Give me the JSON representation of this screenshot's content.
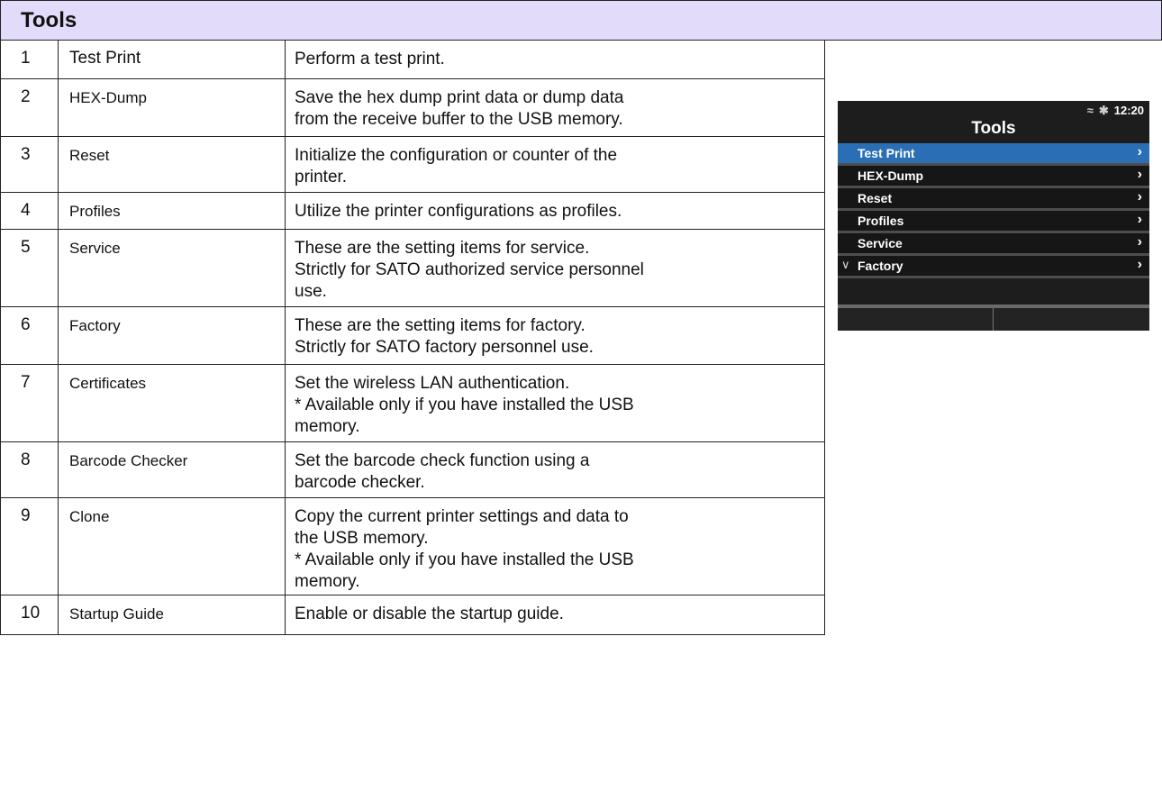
{
  "header": {
    "title": "Tools"
  },
  "rows": [
    {
      "num": "1",
      "name": "Test Print",
      "desc": [
        "Perform a test print."
      ]
    },
    {
      "num": "2",
      "name": "HEX-Dump",
      "desc": [
        "Save the hex dump print data or dump data",
        "from the receive buffer to the USB memory."
      ]
    },
    {
      "num": "3",
      "name": "Reset",
      "desc": [
        "Initialize the configuration or counter of the",
        "printer."
      ]
    },
    {
      "num": "4",
      "name": "Profiles",
      "desc": [
        "Utilize the printer configurations as profiles."
      ]
    },
    {
      "num": "5",
      "name": "Service",
      "desc": [
        "These are the setting items for service.",
        "Strictly for SATO authorized service personnel",
        "use."
      ]
    },
    {
      "num": "6",
      "name": "Factory",
      "desc": [
        "These are the setting items for factory.",
        "Strictly for SATO factory personnel use."
      ]
    },
    {
      "num": "7",
      "name": "Certificates",
      "desc": [
        "Set the wireless LAN authentication.",
        "* Available only if you have installed the USB",
        "memory."
      ]
    },
    {
      "num": "8",
      "name": "Barcode Checker",
      "desc": [
        "Set the barcode check function using a",
        "barcode checker."
      ]
    },
    {
      "num": "9",
      "name": "Clone",
      "desc": [
        "Copy the current printer settings and data to",
        "the USB memory.",
        "* Available only if you have installed the USB",
        "memory."
      ]
    },
    {
      "num": "10",
      "name": "Startup Guide",
      "desc": [
        "Enable or disable the startup guide."
      ]
    }
  ],
  "device": {
    "time": "12:20",
    "icons": [
      "wifi-icon",
      "bluetooth-icon"
    ],
    "title": "Tools",
    "items": [
      {
        "label": "Test Print",
        "selected": true
      },
      {
        "label": "HEX-Dump",
        "selected": false
      },
      {
        "label": "Reset",
        "selected": false
      },
      {
        "label": "Profiles",
        "selected": false
      },
      {
        "label": "Service",
        "selected": false
      },
      {
        "label": "Factory",
        "selected": false
      }
    ],
    "colors": {
      "selected": "#2a6fb6",
      "background": "#1d1d1d"
    }
  }
}
